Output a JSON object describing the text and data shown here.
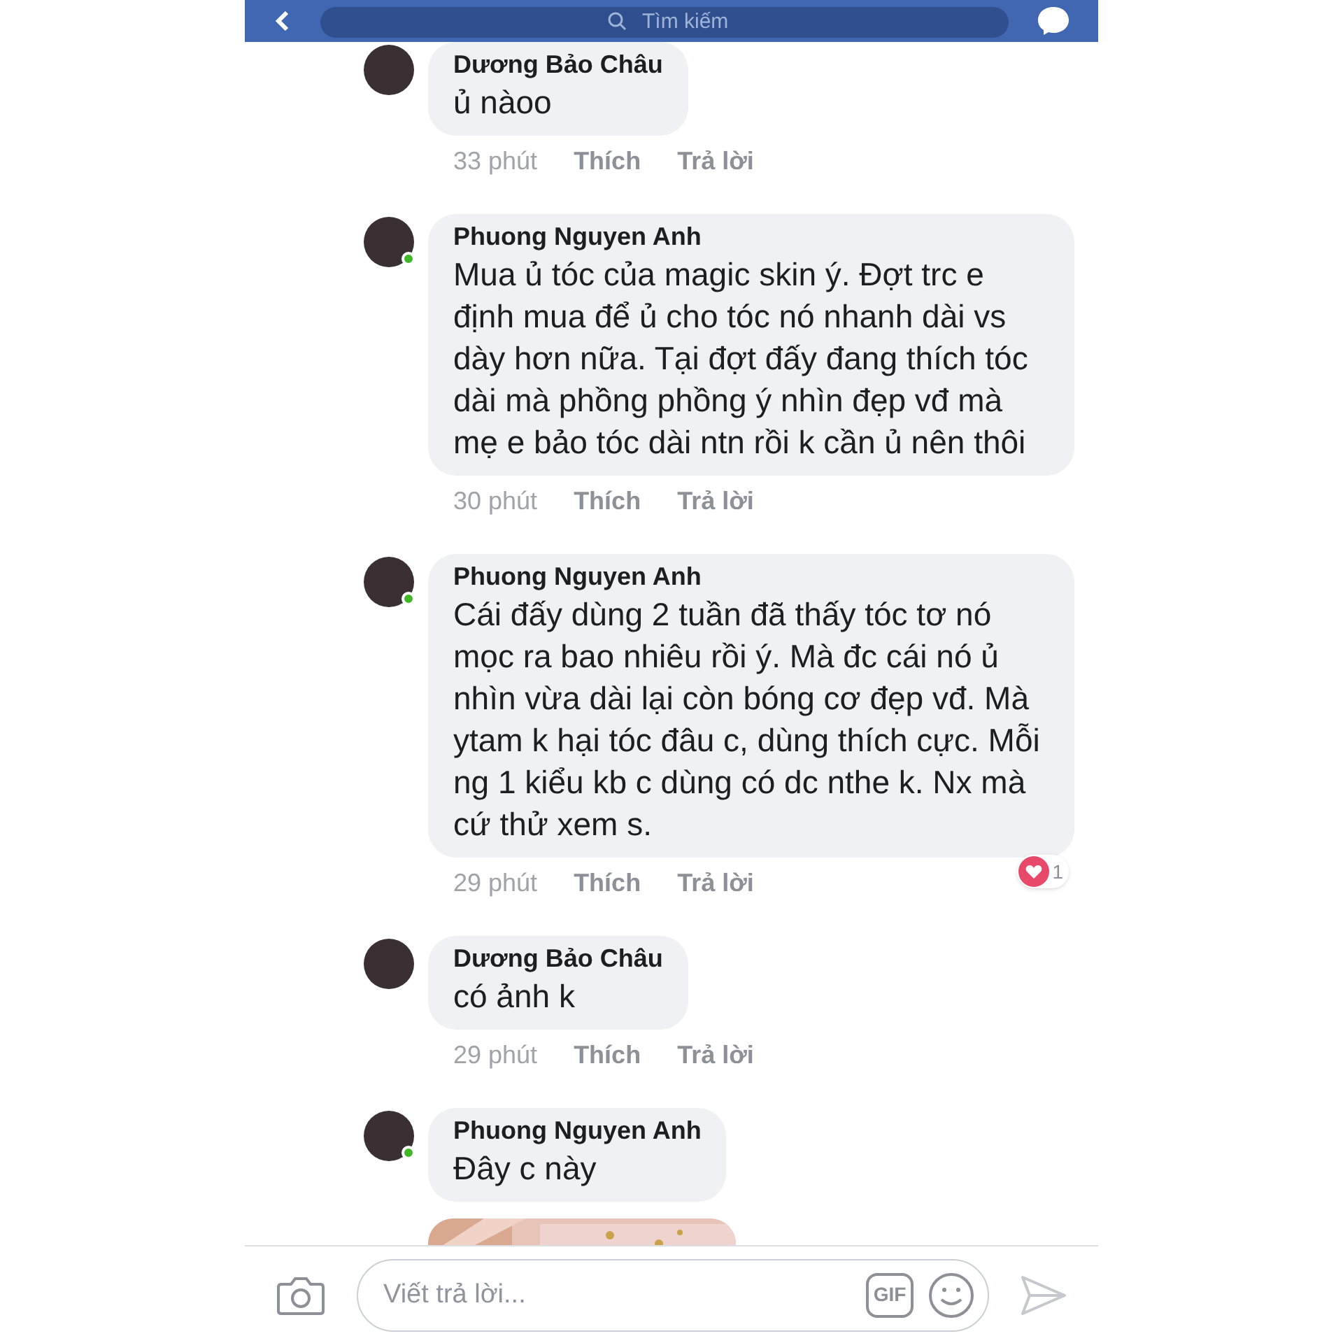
{
  "top_bar": {
    "search": {
      "placeholder": "Tìm kiếm"
    }
  },
  "comments": [
    {
      "author": "Dương Bảo Châu",
      "online": false,
      "text": "ủ nàoo",
      "time": "33 phút",
      "like": "Thích",
      "reply": "Trả lời"
    },
    {
      "author": "Phuong Nguyen Anh",
      "online": true,
      "text": "Mua ủ tóc của magic skin ý. Đợt trc e định mua để ủ cho tóc nó nhanh dài vs dày hơn nữa. Tại đợt đấy đang thích tóc dài mà phồng phồng ý nhìn đẹp vđ mà mẹ e bảo tóc dài ntn rồi k cần ủ nên thôi",
      "time": "30 phút",
      "like": "Thích",
      "reply": "Trả lời"
    },
    {
      "author": "Phuong Nguyen Anh",
      "online": true,
      "text": "Cái đấy dùng 2 tuần đã thấy tóc tơ nó mọc ra bao nhiêu rồi ý. Mà đc cái nó ủ nhìn vừa dài lại còn bóng cơ đẹp vđ. Mà ytam k hại tóc đâu c, dùng thích cực. Mỗi ng 1 kiểu kb c dùng có dc nthe k. Nx mà cứ thử xem s.",
      "time": "29 phút",
      "like": "Thích",
      "reply": "Trả lời",
      "reaction_count": "1"
    },
    {
      "author": "Dương Bảo Châu",
      "online": false,
      "text": "có ảnh k",
      "time": "29 phút",
      "like": "Thích",
      "reply": "Trả lời"
    },
    {
      "author": "Phuong Nguyen Anh",
      "online": true,
      "text": "Đây c này"
    }
  ],
  "composer": {
    "placeholder": "Viết trả lời...",
    "gif": "GIF"
  }
}
